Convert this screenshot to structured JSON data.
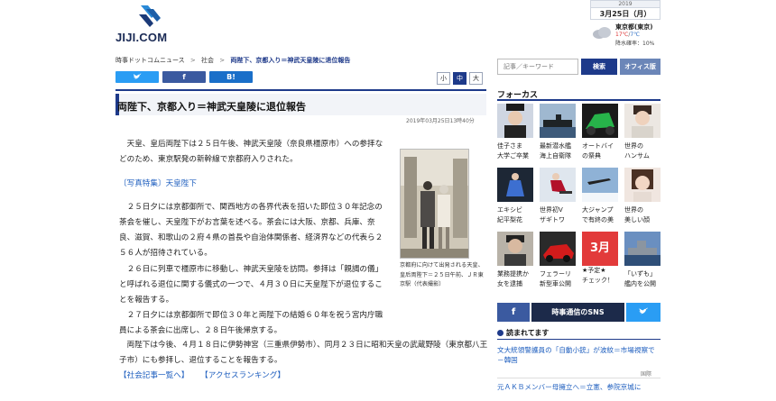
{
  "header": {
    "logo_text": "JIJI.COM",
    "date_year": "2019",
    "date_day": "3月25日（月）",
    "weather": {
      "city": "東京都(東京)",
      "temp_high": "17℃",
      "temp_sep": "/",
      "temp_low": "7℃",
      "rain": "降水確率：10%",
      "icon": "cloud-icon"
    }
  },
  "breadcrumb": {
    "items": [
      "時事ドットコムニュース",
      ">",
      "社会",
      ">",
      "両陛下、京都入り＝神武天皇陵に退位報告"
    ]
  },
  "share": {
    "twitter_icon": "twitter-icon",
    "facebook_label": "f",
    "hatena_label": "B!"
  },
  "font_size": {
    "small": "小",
    "medium": "中",
    "large": "大"
  },
  "article": {
    "title": "両陛下、京都入り＝神武天皇陵に退位報告",
    "timestamp": "2019年03月25日13時40分",
    "p1": "天皇、皇后両陛下は２５日午後、神武天皇陵（奈良県橿原市）への参拝などのため、東京駅発の新幹線で京都府入りされた。",
    "link_photo": "〔写真特集〕天皇陛下",
    "p2": "２５日夕には京都御所で、関西地方の各界代表を招いた即位３０年記念の茶会を催し、天皇陛下がお言葉を述べる。茶会には大阪、京都、兵庫、奈良、滋賀、和歌山の２府４県の首長や自治体関係者、経済界などの代表ら２５６人が招待されている。",
    "p3": "２６日に列車で橿原市に移動し、神武天皇陵を訪問。参拝は「親謁の儀」と呼ばれる退位に関する儀式の一つで、４月３０日に天皇陛下が退位することを報告する。",
    "p4": "２７日夕には京都御所で即位３０年と両陛下の結婚６０年を祝う宮内庁職員による茶会に出席し、２８日午後帰京する。",
    "p5": "両陛下は今後、４月１８日に伊勢神宮（三重県伊勢市）、同月２３日に昭和天皇の武蔵野陵（東京都八王子市）にも参拝し、退位することを報告する。",
    "link_social": "【社会記事一覧へ】",
    "link_ranking": "【アクセスランキング】",
    "photo_caption": "京都府に向けて出発される天皇、皇后両陛下＝２５日午前、ＪＲ東京駅（代表撮影）"
  },
  "sidebar": {
    "search_placeholder": "記事／キーワード",
    "search_button": "検索",
    "office_button": "オフィス版",
    "focus_title": "フォーカス",
    "tiles": [
      {
        "l1": "佳子さま",
        "l2": "大学ご卒業"
      },
      {
        "l1": "最新潜水艦",
        "l2": "海上自衛隊"
      },
      {
        "l1": "オートバイ",
        "l2": "の祭典"
      },
      {
        "l1": "世界の",
        "l2": "ハンサム"
      },
      {
        "l1": "エキシビ",
        "l2": "紀平梨花"
      },
      {
        "l1": "世界初V",
        "l2": "ザギトワ"
      },
      {
        "l1": "大ジャンプ",
        "l2": "で有終の美"
      },
      {
        "l1": "世界の",
        "l2": "美しい顔"
      },
      {
        "l1": "業務提携か",
        "l2": "女を逮捕"
      },
      {
        "l1": "フェラーリ",
        "l2": "新型車公開"
      },
      {
        "l1": "★予定★",
        "l2": "チェック！"
      },
      {
        "l1": "「いずも」",
        "l2": "艦内を公開"
      }
    ],
    "tile_badge": "3月",
    "sns_facebook": "f",
    "sns_label": "時事通信のSNS",
    "sns_twitter_icon": "twitter-icon",
    "popular_title": "読まれてます",
    "popular": [
      {
        "text": "文大統領警護員の「自動小銃」が波紋＝市場視察で－韓国",
        "tag": "国際"
      },
      {
        "text": "元ＡＫＢメンバー母擁立へ＝立憲、参院京城に"
      }
    ]
  }
}
